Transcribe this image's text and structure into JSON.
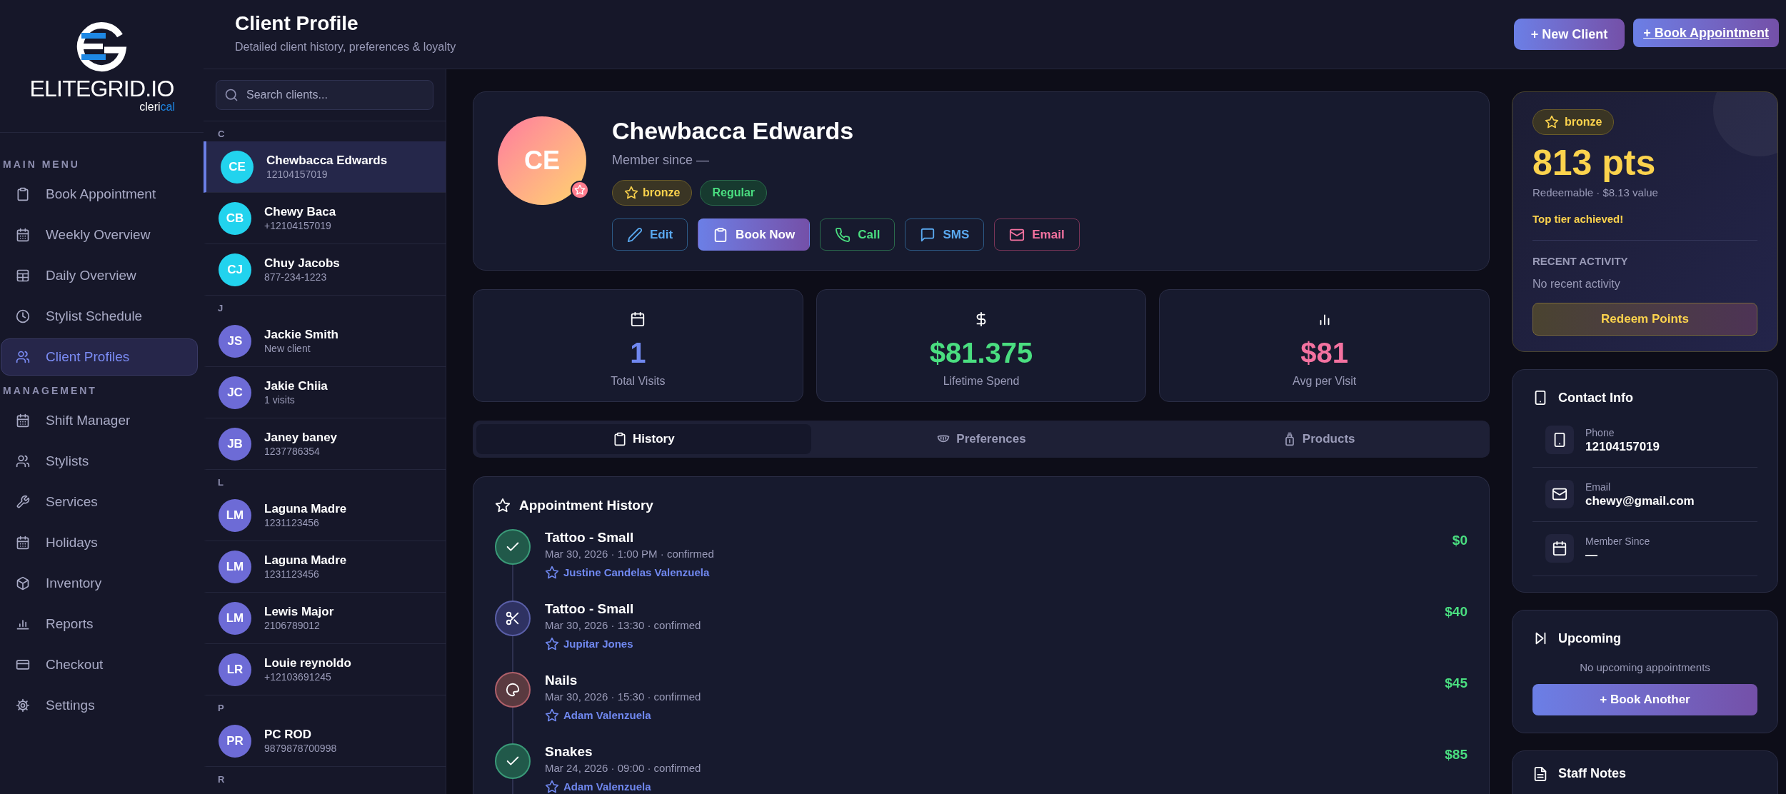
{
  "logo": {
    "wordmark": "ELITEGRID.IO",
    "tagline": "cleri",
    "tagline_accent": "cal"
  },
  "sidebar": {
    "sections": [
      {
        "title": "MAIN MENU",
        "items": [
          {
            "label": "Book Appointment",
            "selected": false
          },
          {
            "label": "Weekly Overview",
            "selected": false
          },
          {
            "label": "Daily Overview",
            "selected": false
          },
          {
            "label": "Stylist Schedule",
            "selected": false
          },
          {
            "label": "Client Profiles",
            "selected": true
          }
        ]
      },
      {
        "title": "MANAGEMENT",
        "items": [
          {
            "label": "Shift Manager",
            "selected": false
          },
          {
            "label": "Stylists",
            "selected": false
          },
          {
            "label": "Services",
            "selected": false
          },
          {
            "label": "Holidays",
            "selected": false
          },
          {
            "label": "Inventory",
            "selected": false
          },
          {
            "label": "Reports",
            "selected": false
          },
          {
            "label": "Checkout",
            "selected": false
          },
          {
            "label": "Settings",
            "selected": false
          }
        ]
      }
    ]
  },
  "header": {
    "title": "Client Profile",
    "subtitle": "Detailed client history, preferences & loyalty",
    "buttons": [
      {
        "label": "+ New Client",
        "kind": "solid"
      },
      {
        "label": "+ Book Appointment",
        "kind": "link"
      }
    ]
  },
  "client_list": {
    "search": {
      "placeholder": "Search clients..."
    },
    "groups": [
      {
        "letter": "C",
        "clients": [
          {
            "initials": "CE",
            "name": "Chewbacca Edwards",
            "detail": "12104157019",
            "selected": true,
            "color": "#22d3ee"
          },
          {
            "initials": "CB",
            "name": "Chewy Baca",
            "detail": "+12104157019",
            "selected": false,
            "color": "#22d3ee"
          },
          {
            "initials": "CJ",
            "name": "Chuy Jacobs",
            "detail": "877-234-1223",
            "selected": false,
            "color": "#22d3ee"
          }
        ]
      },
      {
        "letter": "J",
        "clients": [
          {
            "initials": "JS",
            "name": "Jackie Smith",
            "detail": "New client",
            "selected": false,
            "color": "#6d6bd6"
          },
          {
            "initials": "JC",
            "name": "Jakie Chiia",
            "detail": "1 visits",
            "selected": false,
            "color": "#6d6bd6"
          },
          {
            "initials": "JB",
            "name": "Janey baney",
            "detail": "1237786354",
            "selected": false,
            "color": "#6d6bd6"
          }
        ]
      },
      {
        "letter": "L",
        "clients": [
          {
            "initials": "LM",
            "name": "Laguna Madre",
            "detail": "1231123456",
            "selected": false,
            "color": "#6d6bd6"
          },
          {
            "initials": "LM",
            "name": "Laguna Madre",
            "detail": "1231123456",
            "selected": false,
            "color": "#6d6bd6"
          },
          {
            "initials": "LM",
            "name": "Lewis Major",
            "detail": "2106789012",
            "selected": false,
            "color": "#6d6bd6"
          },
          {
            "initials": "LR",
            "name": "Louie reynoldo",
            "detail": "+12103691245",
            "selected": false,
            "color": "#6d6bd6"
          }
        ]
      },
      {
        "letter": "P",
        "clients": [
          {
            "initials": "PR",
            "name": "PC ROD",
            "detail": "9879878700998",
            "selected": false,
            "color": "#6d6bd6"
          }
        ]
      },
      {
        "letter": "R"
      }
    ]
  },
  "profile": {
    "initials": "CE",
    "name": "Chewbacca Edwards",
    "member_since": "Member since —",
    "badges": [
      {
        "label": "bronze",
        "kind": "tier"
      },
      {
        "label": "Regular",
        "kind": "status"
      }
    ],
    "actions": [
      {
        "label": "Edit",
        "kind": "edit"
      },
      {
        "label": "Book Now",
        "kind": "book"
      },
      {
        "label": "Call",
        "kind": "call"
      },
      {
        "label": "SMS",
        "kind": "sms"
      },
      {
        "label": "Email",
        "kind": "email"
      }
    ]
  },
  "stats": [
    {
      "value": "1",
      "label": "Total Visits",
      "kind": "visits"
    },
    {
      "value": "$81.375",
      "label": "Lifetime Spend",
      "kind": "spend"
    },
    {
      "value": "$81",
      "label": "Avg per Visit",
      "kind": "average"
    }
  ],
  "tabs": [
    {
      "label": "History",
      "selected": true,
      "kind": "history"
    },
    {
      "label": "Preferences",
      "selected": false,
      "kind": "preferences"
    },
    {
      "label": "Products",
      "selected": false,
      "kind": "products"
    }
  ],
  "history": {
    "title": "Appointment History",
    "entries": [
      {
        "service": "Tattoo - Small",
        "meta": "Mar 30, 2026 · 1:00 PM · confirmed",
        "stylist": "Justine Candelas Valenzuela",
        "price": "$0",
        "kind": "check"
      },
      {
        "service": "Tattoo - Small",
        "meta": "Mar 30, 2026 · 13:30 · confirmed",
        "stylist": "Jupitar Jones",
        "price": "$40",
        "kind": "scissors"
      },
      {
        "service": "Nails",
        "meta": "Mar 30, 2026 · 15:30 · confirmed",
        "stylist": "Adam Valenzuela",
        "price": "$45",
        "kind": "nails"
      },
      {
        "service": "Snakes",
        "meta": "Mar 24, 2026 · 09:00 · confirmed",
        "stylist": "Adam Valenzuela",
        "price": "$85",
        "kind": "check"
      }
    ]
  },
  "loyalty": {
    "tier": "bronze",
    "points": "813 pts",
    "value_note": "Redeemable · $8.13 value",
    "tier_note": "Top tier achieved!",
    "recent_title": "RECENT ACTIVITY",
    "recent_empty": "No recent activity",
    "button": "Redeem Points"
  },
  "contact": {
    "title": "Contact Info",
    "fields": [
      {
        "label": "Phone",
        "value": "12104157019",
        "kind": "phone"
      },
      {
        "label": "Email",
        "value": "chewy@gmail.com",
        "kind": "email"
      },
      {
        "label": "Member Since",
        "value": "—",
        "kind": "date"
      }
    ]
  },
  "upcoming": {
    "title": "Upcoming",
    "empty": "No upcoming appointments",
    "button": "+ Book Another"
  },
  "staff_notes": {
    "title": "Staff Notes"
  }
}
